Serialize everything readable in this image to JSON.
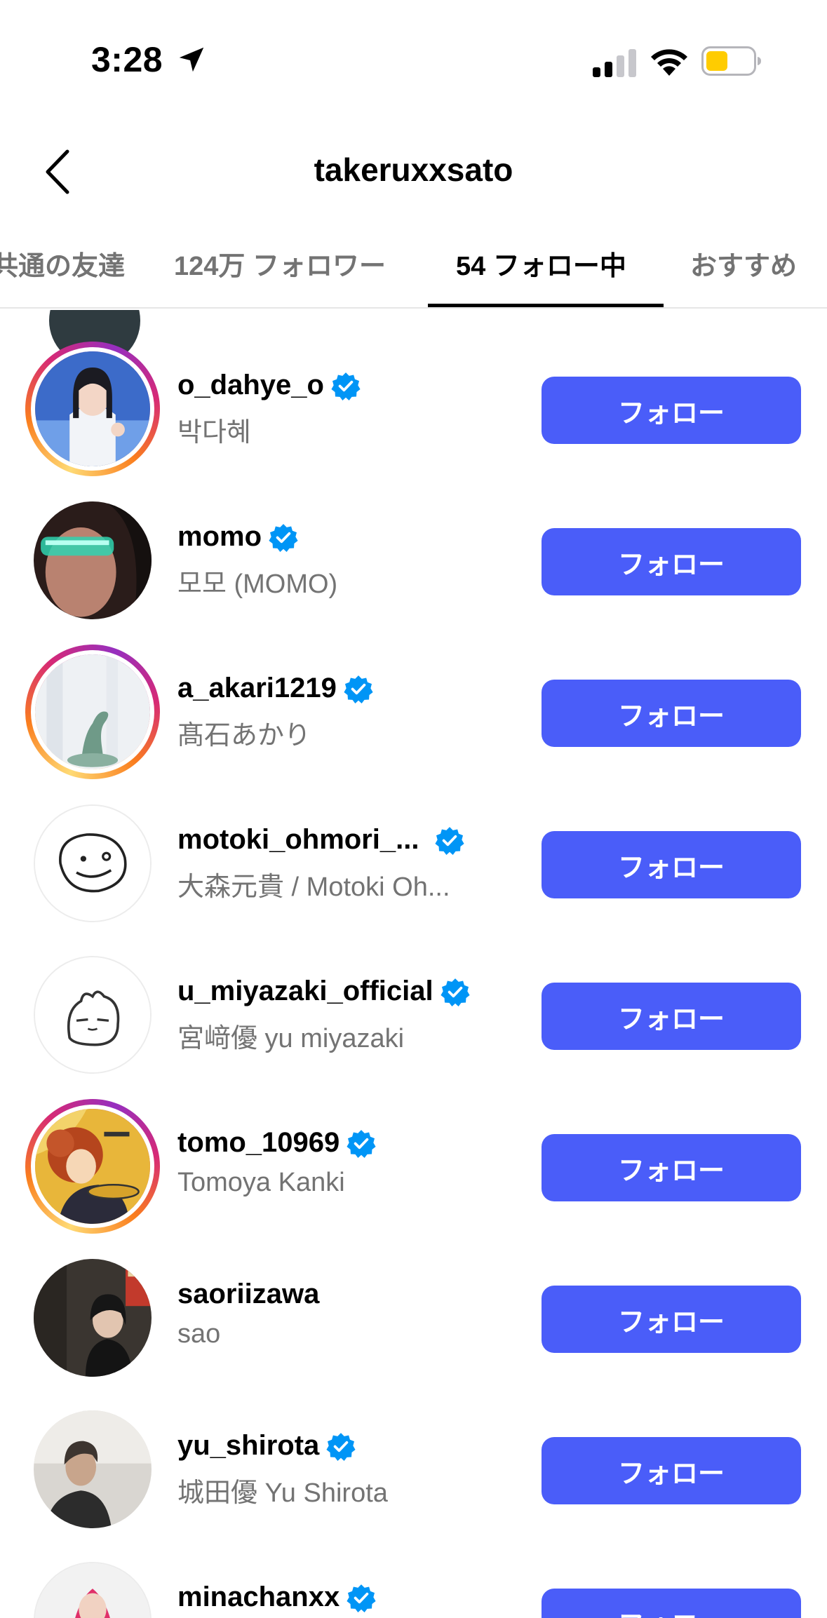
{
  "status_bar": {
    "time": "3:28"
  },
  "header": {
    "title": "takeruxxsato"
  },
  "tabs": [
    {
      "label": "共通の友達",
      "active": false
    },
    {
      "label": "124万 フォロワー",
      "active": false
    },
    {
      "label": "54 フォロー中",
      "active": true
    },
    {
      "label": "おすすめ",
      "active": false
    }
  ],
  "colors": {
    "accent": "#4a5df9",
    "verified": "#0095f6",
    "secondary_text": "#737373"
  },
  "users": [
    {
      "username": "o_dahye_o",
      "full_name": "박다혜",
      "verified": true,
      "story_ring": true,
      "button": "フォロー"
    },
    {
      "username": "momo",
      "full_name": "모모 (MOMO)",
      "verified": true,
      "story_ring": false,
      "button": "フォロー"
    },
    {
      "username": "a_akari1219",
      "full_name": "髙石あかり",
      "verified": true,
      "story_ring": true,
      "button": "フォロー"
    },
    {
      "username": "motoki_ohmori_...",
      "full_name": "大森元貴 / Motoki Oh...",
      "verified": true,
      "story_ring": false,
      "button": "フォロー"
    },
    {
      "username": "u_miyazaki_official",
      "full_name": "宮﨑優 yu miyazaki",
      "verified": true,
      "story_ring": false,
      "button": "フォロー"
    },
    {
      "username": "tomo_10969",
      "full_name": "Tomoya Kanki",
      "verified": true,
      "story_ring": true,
      "button": "フォロー"
    },
    {
      "username": "saoriizawa",
      "full_name": "sao",
      "verified": false,
      "story_ring": false,
      "button": "フォロー"
    },
    {
      "username": "yu_shirota",
      "full_name": "城田優 Yu Shirota",
      "verified": true,
      "story_ring": false,
      "button": "フォロー"
    },
    {
      "username": "minachanxx",
      "full_name": "",
      "verified": true,
      "story_ring": false,
      "button": "フォロー"
    }
  ]
}
